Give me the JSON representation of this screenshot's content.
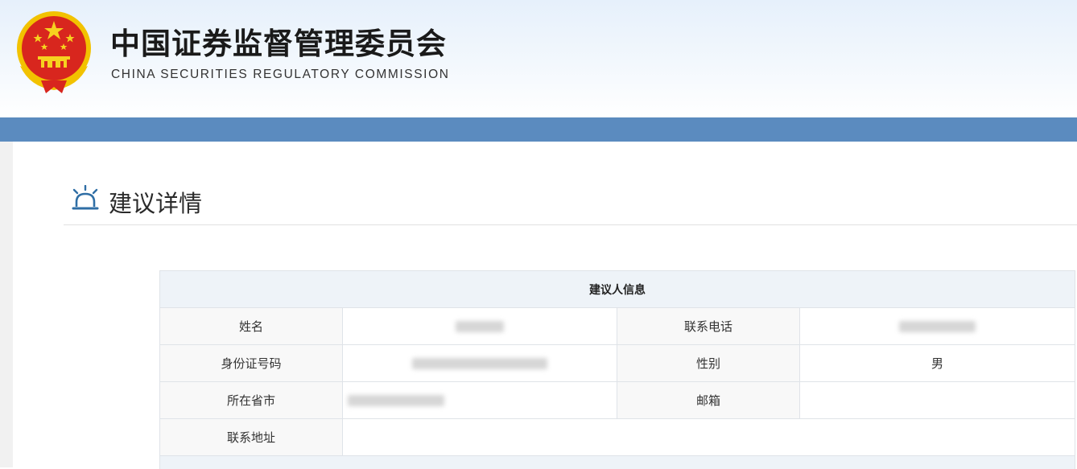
{
  "header": {
    "cn_title": "中国证券监督管理委员会",
    "en_title": "CHINA SECURITIES REGULATORY COMMISSION",
    "emblem_icon": "national-emblem-icon"
  },
  "colors": {
    "nav_bar": "#5b8bbf",
    "emblem_red": "#d8261e",
    "emblem_gold": "#f2c200",
    "section_icon": "#2f6ea5"
  },
  "section": {
    "title": "建议详情",
    "icon": "bell-icon"
  },
  "table": {
    "caption": "建议人信息",
    "rows": [
      {
        "label1": "姓名",
        "value1": "",
        "label2": "联系电话",
        "value2": ""
      },
      {
        "label1": "身份证号码",
        "value1": "",
        "label2": "性别",
        "value2": "男"
      },
      {
        "label1": "所在省市",
        "value1": "",
        "label2": "邮箱",
        "value2": ""
      },
      {
        "label1": "联系地址",
        "value1": ""
      }
    ]
  }
}
